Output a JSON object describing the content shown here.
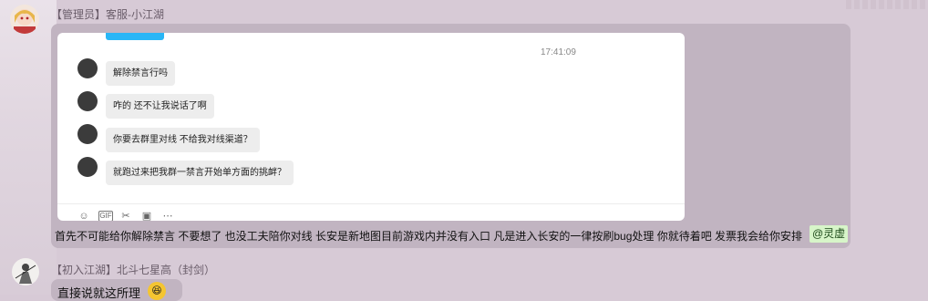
{
  "messages": [
    {
      "sender": "【管理员】客服-小江湖",
      "avatar": "anime-girl-avatar",
      "screenshot": {
        "time": "17:41:09",
        "chat": [
          "解除禁言行吗",
          "咋的 还不让我说话了啊",
          "你要去群里对线 不给我对线渠道？",
          "就跑过来把我群一禁言开始单方面的挑衅？"
        ],
        "toolbar": [
          "smile-icon",
          "gif-icon",
          "scissors-icon",
          "image-icon",
          "more-icon"
        ]
      },
      "text": "首先不可能给你解除禁言 不要想了 也没工夫陪你对线 长安是新地图目前游戏内并没有入口 凡是进入长安的一律按刷bug处理 你就待着吧 发票我会给你安排",
      "mention": "@灵虚"
    },
    {
      "sender": "【初入江湖】北斗七星高（封剑）",
      "avatar": "ink-swordsman-avatar",
      "text": "直接说就这所理",
      "emoji": "laughing-face-icon"
    }
  ],
  "colors": {
    "background": "#d7cad6",
    "bubble": "#c1b4c1",
    "mention_bg": "#d7f5c9",
    "accent_button": "#29b6f6"
  }
}
